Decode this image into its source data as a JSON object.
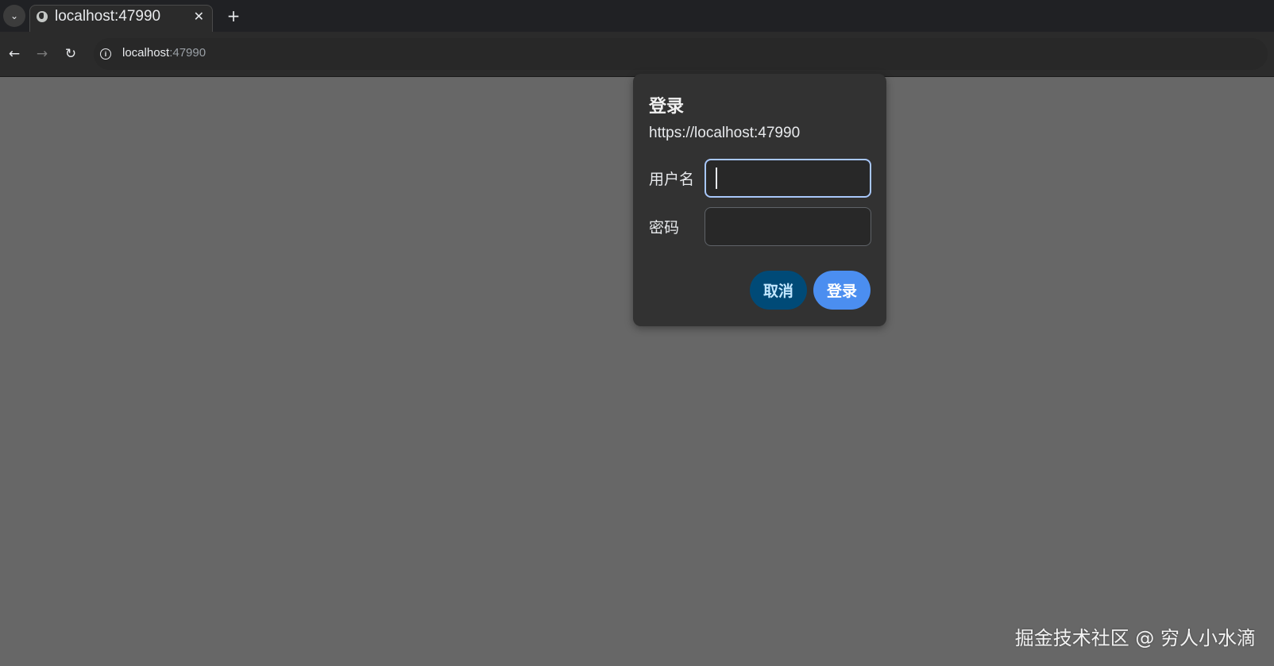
{
  "browser": {
    "tab_list_icon": "chevron-down-icon",
    "tab": {
      "title": "localhost:47990",
      "favicon": "globe-icon",
      "close_symbol": "✕"
    },
    "new_tab_symbol": "+",
    "toolbar": {
      "back_symbol": "←",
      "forward_symbol": "→",
      "reload_symbol": "↻",
      "info_symbol": "i",
      "url_host": "localhost",
      "url_port": ":47990"
    }
  },
  "login_dialog": {
    "title": "登录",
    "url": "https://localhost:47990",
    "username_label": "用户名",
    "username_value": "",
    "password_label": "密码",
    "password_value": "",
    "cancel_label": "取消",
    "login_label": "登录"
  },
  "watermark": "掘金技术社区 @ 穷人小水滴",
  "colors": {
    "page_background": "#676767",
    "dialog_background": "#323232",
    "cancel_button": "#004a77",
    "login_button": "#4b8ef0",
    "focus_ring": "#a8c7fa"
  }
}
